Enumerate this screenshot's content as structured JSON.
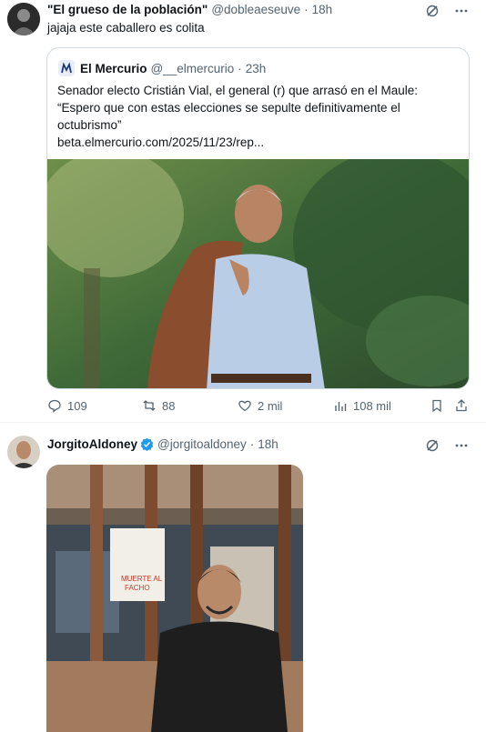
{
  "tweet1": {
    "author": "\"El grueso de la población\"",
    "handle": "@dobleaeseuve",
    "dot": "·",
    "time": "18h",
    "text": "jajaja este caballero es colita",
    "quote": {
      "author": "El Mercurio",
      "handle": "@__elmercurio",
      "dot": "·",
      "time": "23h",
      "text_line1": "Senador electo Cristián Vial, el general (r) que arrasó en el Maule:",
      "text_line2": "“Espero que con estas elecciones se sepulte definitivamente el octubrismo”",
      "link": "beta.elmercurio.com/2025/11/23/rep..."
    },
    "actions": {
      "replies": "109",
      "retweets": "88",
      "likes": "2 mil",
      "views": "108 mil"
    }
  },
  "tweet2": {
    "author": "JorgitoAldoney",
    "handle": "@jorgitoaldoney",
    "dot": "·",
    "time": "18h"
  },
  "colors": {
    "text_primary": "#0f1419",
    "text_secondary": "#536471",
    "verified_blue": "#1d9bf0",
    "border": "#cfd9de"
  },
  "icons": [
    "grok-icon",
    "more-icon",
    "reply-icon",
    "retweet-icon",
    "like-icon",
    "views-icon",
    "bookmark-icon",
    "share-icon",
    "verified-icon"
  ]
}
